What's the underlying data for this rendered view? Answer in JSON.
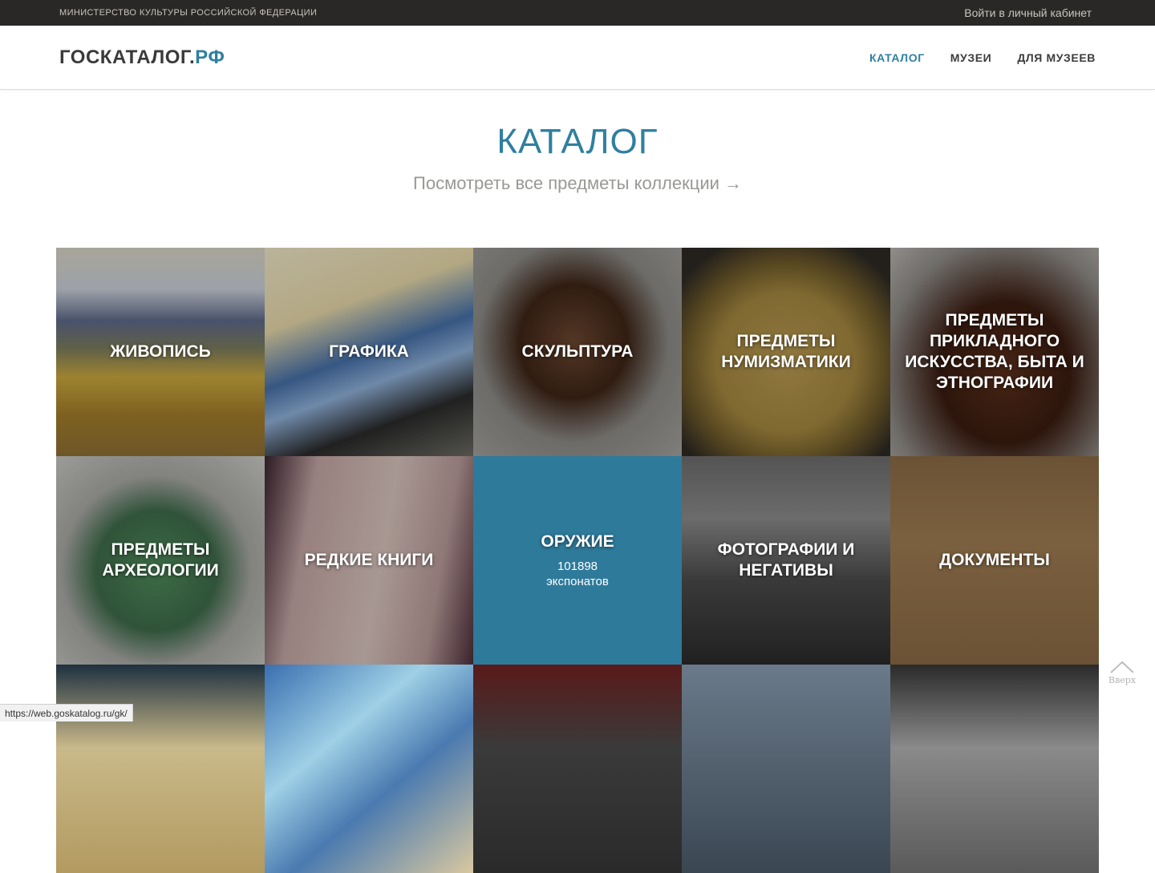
{
  "topbar": {
    "ministry": "Министерство культуры Российской Федерации",
    "login": "Войти в личный кабинет"
  },
  "header": {
    "logo_main": "ГОСКАТАЛОГ.",
    "logo_rf": "РФ",
    "nav": [
      {
        "label": "КАТАЛОГ",
        "active": true
      },
      {
        "label": "МУЗЕИ",
        "active": false
      },
      {
        "label": "ДЛЯ МУЗЕЕВ",
        "active": false
      }
    ]
  },
  "main": {
    "title": "КАТАЛОГ",
    "view_all": "Посмотреть все предметы коллекции",
    "view_all_icon": "arrow-right-icon"
  },
  "tiles": [
    {
      "label": "ЖИВОПИСЬ"
    },
    {
      "label": "ГРАФИКА"
    },
    {
      "label": "СКУЛЬПТУРА"
    },
    {
      "label": "ПРЕДМЕТЫ НУМИЗМАТИКИ"
    },
    {
      "label": "ПРЕДМЕТЫ ПРИКЛАДНОГО ИСКУССТВА, БЫТА И ЭТНОГРАФИИ"
    },
    {
      "label": "ПРЕДМЕТЫ АРХЕОЛОГИИ"
    },
    {
      "label": "РЕДКИЕ КНИГИ"
    },
    {
      "label": "ОРУЖИЕ",
      "count": "101898",
      "count_unit": "экспонатов"
    },
    {
      "label": "ФОТОГРАФИИ И НЕГАТИВЫ"
    },
    {
      "label": "ДОКУМЕНТЫ"
    }
  ],
  "back_to_top": {
    "label": "Вверх",
    "icon": "chevron-up-icon"
  },
  "status_url": "https://web.goskatalog.ru/gk/",
  "colors": {
    "accent": "#2f7fa0",
    "topbar_bg": "#2a2826",
    "active_tile": "#2e7a9a"
  }
}
